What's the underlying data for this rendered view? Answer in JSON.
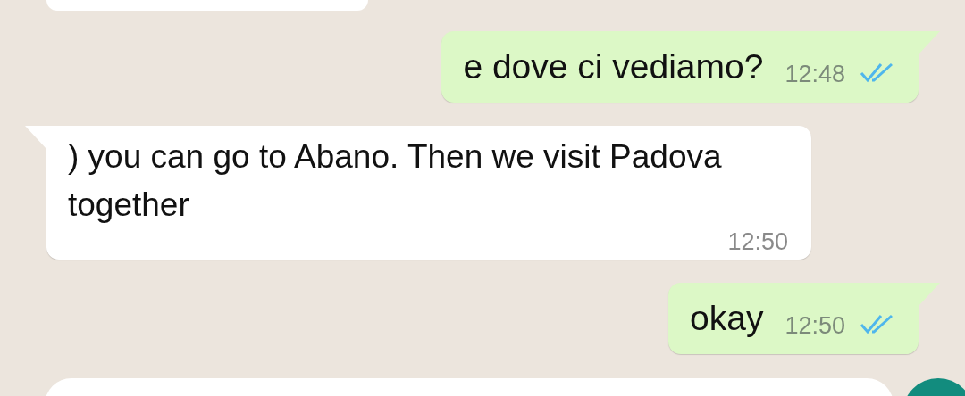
{
  "messages": [
    {
      "kind": "outgoing",
      "text": "e dove ci vediamo?",
      "time": "12:48",
      "read": true
    },
    {
      "kind": "incoming",
      "text": ") you can go to Abano. Then we visit Padova together",
      "time": "12:50"
    },
    {
      "kind": "outgoing",
      "text": "okay",
      "time": "12:50",
      "read": true
    }
  ]
}
